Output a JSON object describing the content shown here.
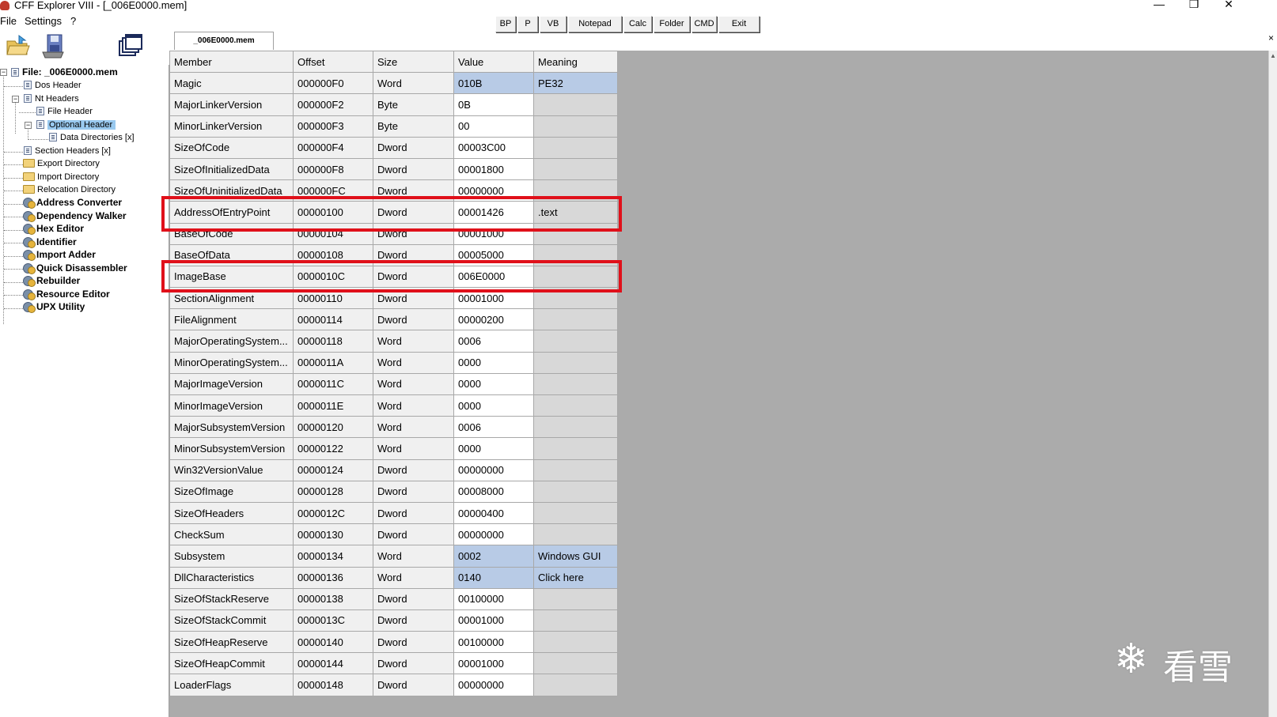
{
  "window": {
    "title": "CFF Explorer VIII - [_006E0000.mem]",
    "minimize": "—",
    "restore": "❐",
    "close": "✕"
  },
  "menu": {
    "file": "File",
    "settings": "Settings",
    "help": "?"
  },
  "toolbar": {
    "bp": "BP",
    "p": "P",
    "vb": "VB",
    "notepad": "Notepad",
    "calc": "Calc",
    "folder": "Folder",
    "cmd": "CMD",
    "exit": "Exit"
  },
  "tab": {
    "label": "_006E0000.mem",
    "close": "×"
  },
  "tree": {
    "root": "File: _006E0000.mem",
    "dos_header": "Dos Header",
    "nt_headers": "Nt Headers",
    "file_header": "File Header",
    "optional_header": "Optional Header",
    "data_directories": "Data Directories [x]",
    "section_headers": "Section Headers [x]",
    "export_directory": "Export Directory",
    "import_directory": "Import Directory",
    "relocation_directory": "Relocation Directory",
    "tools": [
      "Address Converter",
      "Dependency Walker",
      "Hex Editor",
      "Identifier",
      "Import Adder",
      "Quick Disassembler",
      "Rebuilder",
      "Resource Editor",
      "UPX Utility"
    ]
  },
  "grid": {
    "headers": {
      "member": "Member",
      "offset": "Offset",
      "size": "Size",
      "value": "Value",
      "meaning": "Meaning"
    },
    "rows": [
      {
        "member": "Magic",
        "offset": "000000F0",
        "size": "Word",
        "value": "010B",
        "meaning": "PE32",
        "highlight": true
      },
      {
        "member": "MajorLinkerVersion",
        "offset": "000000F2",
        "size": "Byte",
        "value": "0B",
        "meaning": ""
      },
      {
        "member": "MinorLinkerVersion",
        "offset": "000000F3",
        "size": "Byte",
        "value": "00",
        "meaning": ""
      },
      {
        "member": "SizeOfCode",
        "offset": "000000F4",
        "size": "Dword",
        "value": "00003C00",
        "meaning": ""
      },
      {
        "member": "SizeOfInitializedData",
        "offset": "000000F8",
        "size": "Dword",
        "value": "00001800",
        "meaning": ""
      },
      {
        "member": "SizeOfUninitializedData",
        "offset": "000000FC",
        "size": "Dword",
        "value": "00000000",
        "meaning": ""
      },
      {
        "member": "AddressOfEntryPoint",
        "offset": "00000100",
        "size": "Dword",
        "value": "00001426",
        "meaning": ".text"
      },
      {
        "member": "BaseOfCode",
        "offset": "00000104",
        "size": "Dword",
        "value": "00001000",
        "meaning": ""
      },
      {
        "member": "BaseOfData",
        "offset": "00000108",
        "size": "Dword",
        "value": "00005000",
        "meaning": ""
      },
      {
        "member": "ImageBase",
        "offset": "0000010C",
        "size": "Dword",
        "value": "006E0000",
        "meaning": ""
      },
      {
        "member": "SectionAlignment",
        "offset": "00000110",
        "size": "Dword",
        "value": "00001000",
        "meaning": ""
      },
      {
        "member": "FileAlignment",
        "offset": "00000114",
        "size": "Dword",
        "value": "00000200",
        "meaning": ""
      },
      {
        "member": "MajorOperatingSystem...",
        "offset": "00000118",
        "size": "Word",
        "value": "0006",
        "meaning": ""
      },
      {
        "member": "MinorOperatingSystem...",
        "offset": "0000011A",
        "size": "Word",
        "value": "0000",
        "meaning": ""
      },
      {
        "member": "MajorImageVersion",
        "offset": "0000011C",
        "size": "Word",
        "value": "0000",
        "meaning": ""
      },
      {
        "member": "MinorImageVersion",
        "offset": "0000011E",
        "size": "Word",
        "value": "0000",
        "meaning": ""
      },
      {
        "member": "MajorSubsystemVersion",
        "offset": "00000120",
        "size": "Word",
        "value": "0006",
        "meaning": ""
      },
      {
        "member": "MinorSubsystemVersion",
        "offset": "00000122",
        "size": "Word",
        "value": "0000",
        "meaning": ""
      },
      {
        "member": "Win32VersionValue",
        "offset": "00000124",
        "size": "Dword",
        "value": "00000000",
        "meaning": ""
      },
      {
        "member": "SizeOfImage",
        "offset": "00000128",
        "size": "Dword",
        "value": "00008000",
        "meaning": ""
      },
      {
        "member": "SizeOfHeaders",
        "offset": "0000012C",
        "size": "Dword",
        "value": "00000400",
        "meaning": ""
      },
      {
        "member": "CheckSum",
        "offset": "00000130",
        "size": "Dword",
        "value": "00000000",
        "meaning": ""
      },
      {
        "member": "Subsystem",
        "offset": "00000134",
        "size": "Word",
        "value": "0002",
        "meaning": "Windows GUI",
        "highlight": true
      },
      {
        "member": "DllCharacteristics",
        "offset": "00000136",
        "size": "Word",
        "value": "0140",
        "meaning": "Click here",
        "highlight": true
      },
      {
        "member": "SizeOfStackReserve",
        "offset": "00000138",
        "size": "Dword",
        "value": "00100000",
        "meaning": ""
      },
      {
        "member": "SizeOfStackCommit",
        "offset": "0000013C",
        "size": "Dword",
        "value": "00001000",
        "meaning": ""
      },
      {
        "member": "SizeOfHeapReserve",
        "offset": "00000140",
        "size": "Dword",
        "value": "00100000",
        "meaning": ""
      },
      {
        "member": "SizeOfHeapCommit",
        "offset": "00000144",
        "size": "Dword",
        "value": "00001000",
        "meaning": ""
      },
      {
        "member": "LoaderFlags",
        "offset": "00000148",
        "size": "Dword",
        "value": "00000000",
        "meaning": ""
      }
    ]
  },
  "watermark": {
    "text": "看雪",
    "icon": "snowflake-icon"
  },
  "colors": {
    "highlight": "#b8cbe6",
    "selection": "#99c9ef",
    "annotation": "#e0101a",
    "workspace": "#ababab"
  }
}
